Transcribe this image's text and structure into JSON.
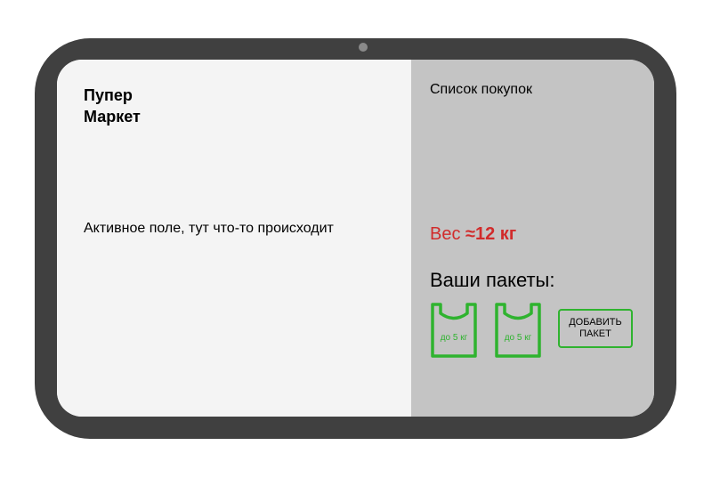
{
  "app": {
    "brand_line1": "Пупер",
    "brand_line2": "Маркет"
  },
  "main": {
    "active_field_text": "Активное поле, тут что-то происходит"
  },
  "sidebar": {
    "title": "Список покупок",
    "weight_prefix": "Вес ",
    "weight_value": "≈12 кг",
    "bags_title": "Ваши пакеты:",
    "bags": [
      {
        "label": "до 5 кг",
        "icon": "shopping-bag-icon"
      },
      {
        "label": "до 5 кг",
        "icon": "shopping-bag-icon"
      }
    ],
    "add_bag_label": "ДОБАВИТЬ ПАКЕТ"
  },
  "colors": {
    "device_frame": "#404040",
    "left_pane": "#f4f4f4",
    "right_pane": "#c4c4c4",
    "weight_text": "#d12b2b",
    "bag_green": "#2fb32f"
  }
}
